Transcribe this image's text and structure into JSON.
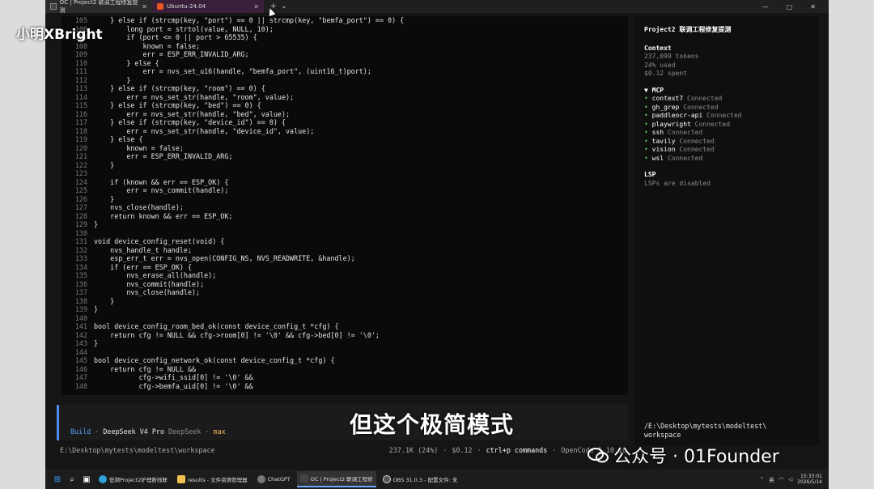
{
  "tabs": [
    {
      "label": "OC | Project2 联调工程修复提测",
      "active": true
    },
    {
      "label": "Ubuntu-24.04",
      "active": false
    }
  ],
  "code_lines": [
    {
      "n": "105",
      "t": "    } else if (strcmp(key, \"port\") == 0 || strcmp(key, \"bemfa_port\") == 0) {"
    },
    {
      "n": "106",
      "t": "        long port = strtol(value, NULL, 10);"
    },
    {
      "n": "107",
      "t": "        if (port <= 0 || port > 65535) {"
    },
    {
      "n": "108",
      "t": "            known = false;"
    },
    {
      "n": "109",
      "t": "            err = ESP_ERR_INVALID_ARG;"
    },
    {
      "n": "110",
      "t": "        } else {"
    },
    {
      "n": "111",
      "t": "            err = nvs_set_u16(handle, \"bemfa_port\", (uint16_t)port);"
    },
    {
      "n": "112",
      "t": "        }"
    },
    {
      "n": "113",
      "t": "    } else if (strcmp(key, \"room\") == 0) {"
    },
    {
      "n": "114",
      "t": "        err = nvs_set_str(handle, \"room\", value);"
    },
    {
      "n": "115",
      "t": "    } else if (strcmp(key, \"bed\") == 0) {"
    },
    {
      "n": "116",
      "t": "        err = nvs_set_str(handle, \"bed\", value);"
    },
    {
      "n": "117",
      "t": "    } else if (strcmp(key, \"device_id\") == 0) {"
    },
    {
      "n": "118",
      "t": "        err = nvs_set_str(handle, \"device_id\", value);"
    },
    {
      "n": "119",
      "t": "    } else {"
    },
    {
      "n": "120",
      "t": "        known = false;"
    },
    {
      "n": "121",
      "t": "        err = ESP_ERR_INVALID_ARG;"
    },
    {
      "n": "122",
      "t": "    }"
    },
    {
      "n": "123",
      "t": ""
    },
    {
      "n": "124",
      "t": "    if (known && err == ESP_OK) {"
    },
    {
      "n": "125",
      "t": "        err = nvs_commit(handle);"
    },
    {
      "n": "126",
      "t": "    }"
    },
    {
      "n": "127",
      "t": "    nvs_close(handle);"
    },
    {
      "n": "128",
      "t": "    return known && err == ESP_OK;"
    },
    {
      "n": "129",
      "t": "}"
    },
    {
      "n": "130",
      "t": ""
    },
    {
      "n": "131",
      "t": "void device_config_reset(void) {"
    },
    {
      "n": "132",
      "t": "    nvs_handle_t handle;"
    },
    {
      "n": "133",
      "t": "    esp_err_t err = nvs_open(CONFIG_NS, NVS_READWRITE, &handle);"
    },
    {
      "n": "134",
      "t": "    if (err == ESP_OK) {"
    },
    {
      "n": "135",
      "t": "        nvs_erase_all(handle);"
    },
    {
      "n": "136",
      "t": "        nvs_commit(handle);"
    },
    {
      "n": "137",
      "t": "        nvs_close(handle);"
    },
    {
      "n": "138",
      "t": "    }"
    },
    {
      "n": "139",
      "t": "}"
    },
    {
      "n": "140",
      "t": ""
    },
    {
      "n": "141",
      "t": "bool device_config_room_bed_ok(const device_config_t *cfg) {"
    },
    {
      "n": "142",
      "t": "    return cfg != NULL && cfg->room[0] != '\\0' && cfg->bed[0] != '\\0';"
    },
    {
      "n": "143",
      "t": "}"
    },
    {
      "n": "144",
      "t": ""
    },
    {
      "n": "145",
      "t": "bool device_config_network_ok(const device_config_t *cfg) {"
    },
    {
      "n": "146",
      "t": "    return cfg != NULL &&"
    },
    {
      "n": "147",
      "t": "           cfg->wifi_ssid[0] != '\\0' &&"
    },
    {
      "n": "148",
      "t": "           cfg->bemfa_uid[0] != '\\0' &&"
    }
  ],
  "sidebar": {
    "title": "Project2 联调工程修复提测",
    "context_head": "Context",
    "tokens": "237,099 tokens",
    "used": "24% used",
    "spent": "$0.12 spent",
    "mcp_head": "▼ MCP",
    "mcp": [
      {
        "name": "context7",
        "status": "Connected"
      },
      {
        "name": "gh_grep",
        "status": "Connected"
      },
      {
        "name": "paddleocr-api",
        "status": "Connected"
      },
      {
        "name": "playwright",
        "status": "Connected"
      },
      {
        "name": "ssh",
        "status": "Connected"
      },
      {
        "name": "tavily",
        "status": "Connected"
      },
      {
        "name": "vision",
        "status": "Connected"
      },
      {
        "name": "wsl",
        "status": "Connected"
      }
    ],
    "lsp_head": "LSP",
    "lsp_status": "LSPs are disabled",
    "path": "/E:\\Desktop\\mytests\\modeltest\\\nworkspace"
  },
  "prompt": {
    "mode": "Build",
    "sep": "·",
    "model": "DeepSeek V4 Pro",
    "provider": "DeepSeek",
    "variant": "max"
  },
  "subtitle": "但这个极简模式",
  "statusline": {
    "path": "E:\\Desktop\\mytests\\modeltest\\workspace",
    "tokens": "237.1K (24%)",
    "cost": "$0.12",
    "shortcut": "ctrl+p commands",
    "app": "OpenCode 1.10.18"
  },
  "taskbar": {
    "apps": [
      {
        "label": "低频Project2护理断线联",
        "icon": "edge"
      },
      {
        "label": "results - 文件资源管理器",
        "icon": "folder"
      },
      {
        "label": "ChatGPT",
        "icon": "chatgpt"
      },
      {
        "label": "OC | Project2 联调工程修",
        "icon": "terminal",
        "active": true
      },
      {
        "label": "OBS 31.0.3 - 配置文件: 未",
        "icon": "obs"
      }
    ],
    "lang": "英",
    "time": "15:33:01",
    "date": "2026/5/14"
  },
  "watermark": {
    "left": "小明XBright",
    "right": "公众号 · 01Founder"
  },
  "colors": {
    "accent_blue": "#4a8df0",
    "highlight_yellow": "#f2d37a",
    "variant_orange": "#f2b35a",
    "background": "#0a0a0a"
  }
}
